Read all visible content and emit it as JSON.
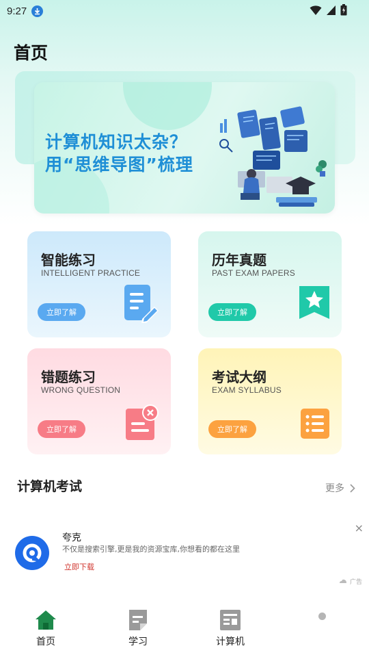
{
  "status": {
    "time": "9:27"
  },
  "page": {
    "title": "首页"
  },
  "banner": {
    "line1": "计算机知识太杂？",
    "line2": "用“思维导图”梳理"
  },
  "cards": [
    {
      "title": "智能练习",
      "subtitle": "INTELLIGENT PRACTICE",
      "button": "立即了解",
      "icon": "document-edit-icon",
      "color": "#5aa9f0"
    },
    {
      "title": "历年真题",
      "subtitle": "PAST EXAM PAPERS",
      "button": "立即了解",
      "icon": "star-bookmark-icon",
      "color": "#20c9a9"
    },
    {
      "title": "错题练习",
      "subtitle": "WRONG QUESTION",
      "button": "立即了解",
      "icon": "error-doc-icon",
      "color": "#f77c86"
    },
    {
      "title": "考试大纲",
      "subtitle": "EXAM SYLLABUS",
      "button": "立即了解",
      "icon": "list-icon",
      "color": "#fca240"
    }
  ],
  "section": {
    "title": "计算机考试",
    "more": "更多"
  },
  "ad": {
    "name": "夸克",
    "description": "不仅是搜索引擎,更是我的资源宝库,你想看的都在这里",
    "download": "立即下载",
    "tag": "广告",
    "close": "×"
  },
  "nav": [
    {
      "label": "首页",
      "icon": "home-icon",
      "active": true
    },
    {
      "label": "学习",
      "icon": "study-icon",
      "active": false
    },
    {
      "label": "计算机",
      "icon": "computer-icon",
      "active": false
    }
  ],
  "colors": {
    "accent": "#1f8a4c",
    "banner_text": "#1f8fd6"
  }
}
